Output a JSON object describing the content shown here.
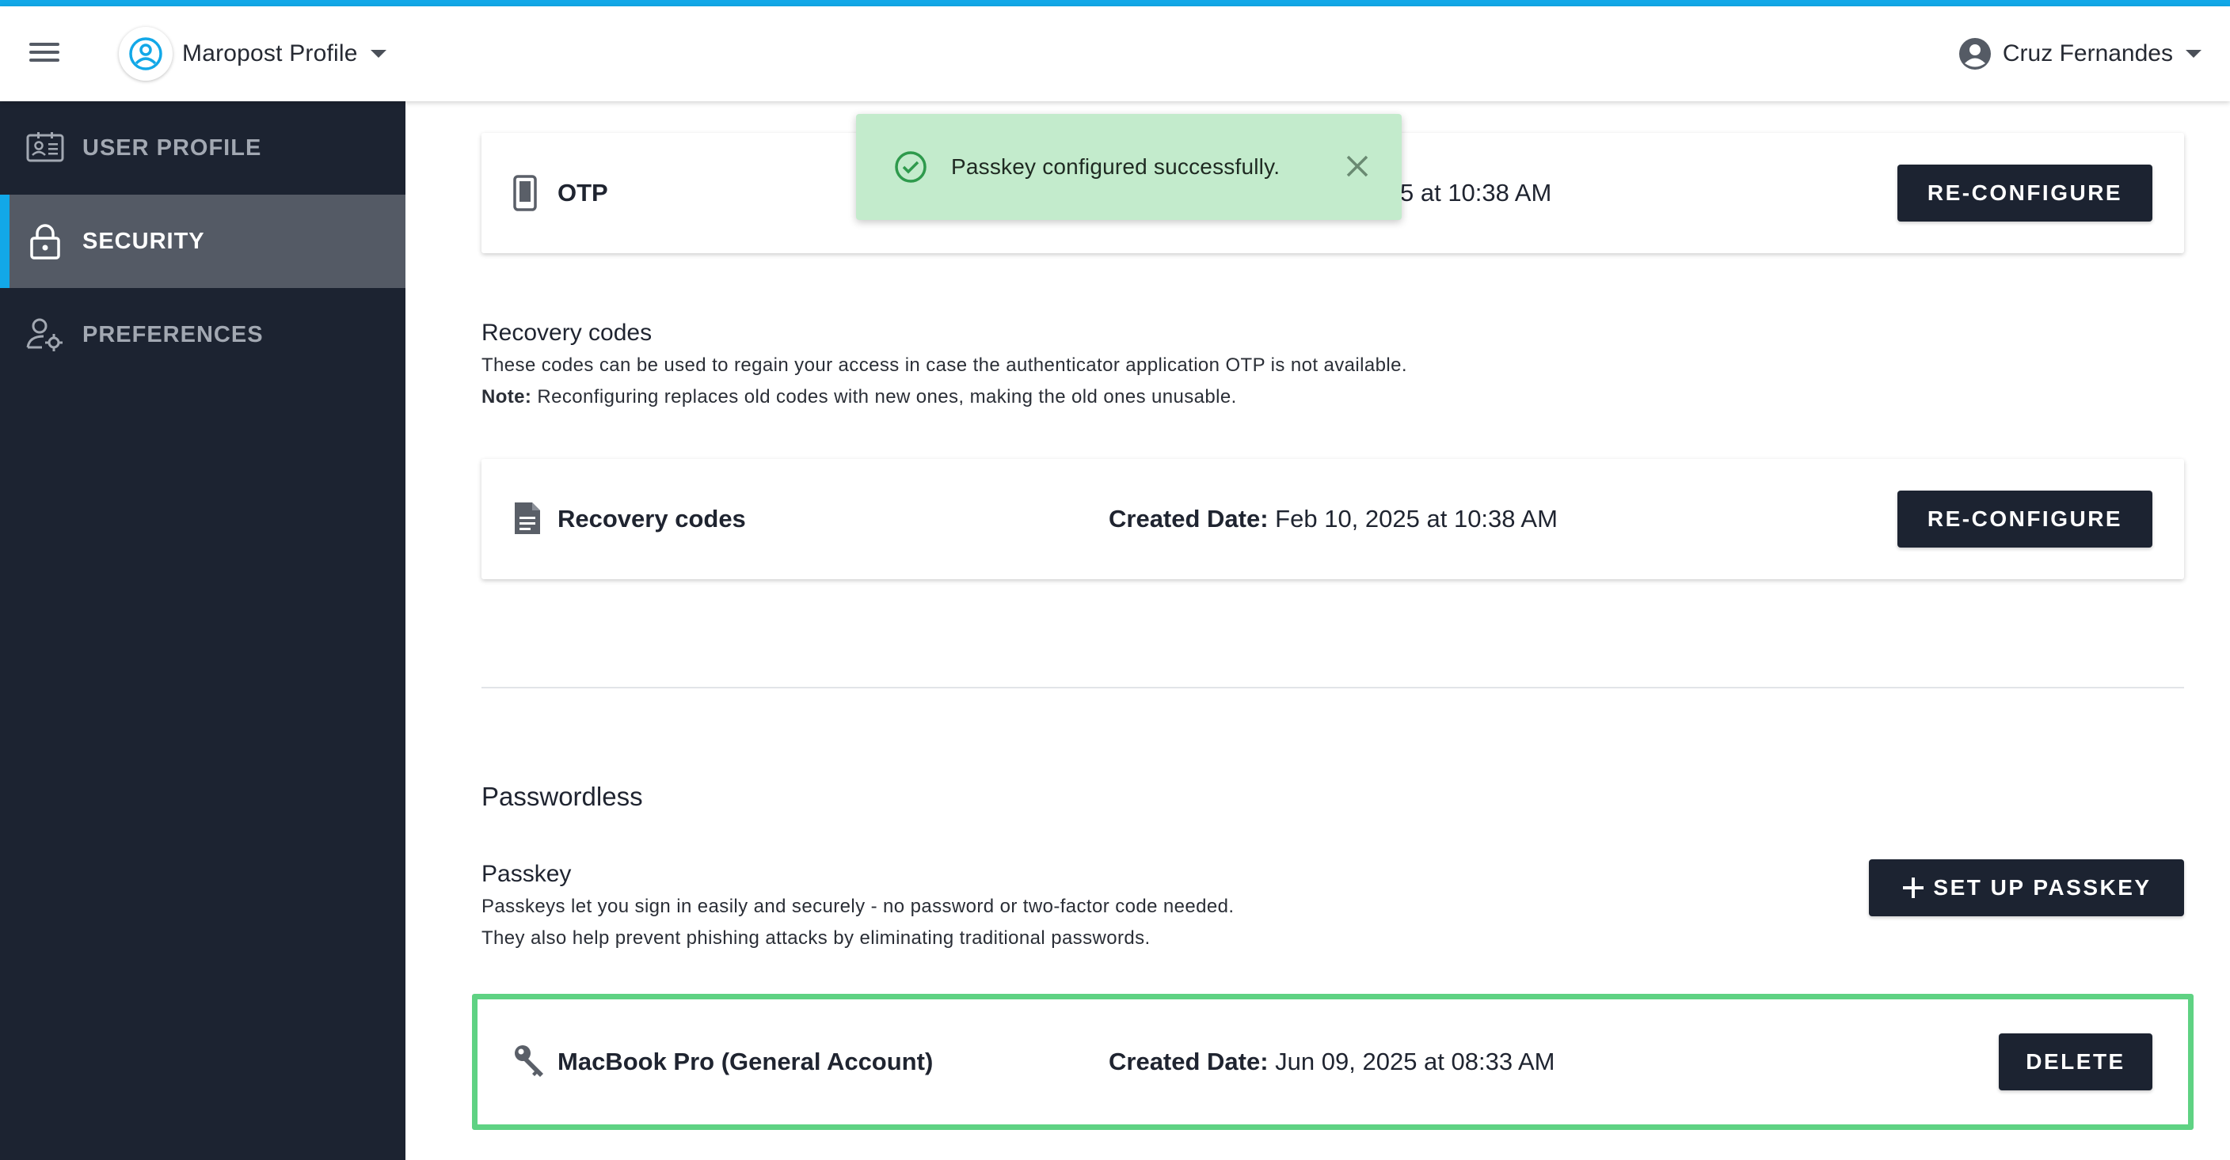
{
  "header": {
    "app_name": "Maropost Profile",
    "user_name": "Cruz Fernandes",
    "menu_icon": "hamburger-menu-icon",
    "app_icon": "profile-circle-icon",
    "user_icon": "account-circle-icon",
    "accent_color": "#12a8e8"
  },
  "sidebar": {
    "items": [
      {
        "label": "USER PROFILE",
        "icon": "contact-card-icon",
        "active": false
      },
      {
        "label": "SECURITY",
        "icon": "lock-icon",
        "active": true
      },
      {
        "label": "PREFERENCES",
        "icon": "user-settings-icon",
        "active": false
      }
    ]
  },
  "toast": {
    "message": "Passkey configured successfully.",
    "icon": "check-circle-icon",
    "close_icon": "close-icon"
  },
  "otp_card": {
    "name": "OTP",
    "icon": "phone-icon",
    "date_tail": "5 at 10:38 AM",
    "button": "RE-CONFIGURE"
  },
  "recovery": {
    "title": "Recovery codes",
    "description": "These codes can be used to regain your access in case the authenticator application OTP is not available.",
    "note_label": "Note:",
    "note_text": " Reconfiguring replaces old codes with new ones, making the old ones unusable.",
    "card": {
      "name": "Recovery codes",
      "icon": "document-icon",
      "date_label": "Created Date:",
      "date_value": " Feb 10, 2025 at 10:38 AM",
      "button": "RE-CONFIGURE"
    }
  },
  "passwordless": {
    "title": "Passwordless",
    "passkey_title": "Passkey",
    "passkey_desc_1": "Passkeys let you sign in easily and securely - no password or two-factor code needed.",
    "passkey_desc_2": "They also help prevent phishing attacks by eliminating traditional passwords.",
    "setup_button": "SET UP PASSKEY",
    "setup_icon": "plus-icon",
    "card": {
      "name": "MacBook Pro (General Account)",
      "icon": "key-icon",
      "date_label": "Created Date:",
      "date_value": " Jun 09, 2025 at 08:33 AM",
      "button": "DELETE",
      "highlight_color": "#5fd283"
    }
  }
}
